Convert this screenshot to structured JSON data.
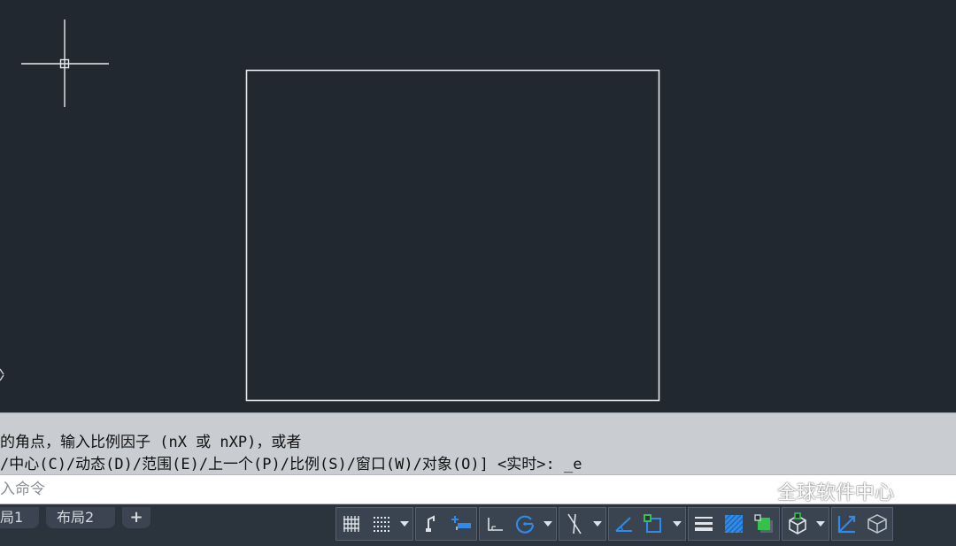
{
  "canvas": {
    "background": "#212830",
    "cursor": "crosshair-cursor-icon",
    "drawn_rectangle": "rectangle"
  },
  "command_history": {
    "line1": "的角点，输入比例因子 (nX 或 nXP)，或者",
    "line2": "/中心(C)/动态(D)/范围(E)/上一个(P)/比例(S)/窗口(W)/对象(O)] <实时>: _e"
  },
  "command_input": {
    "placeholder": "入命令",
    "value": ""
  },
  "watermark": {
    "text": "全球软件中心"
  },
  "layout_tabs": [
    {
      "label": "局1"
    },
    {
      "label": "布局2"
    },
    {
      "label": "+"
    }
  ],
  "status_icons": [
    "grid-icon",
    "grid-dots-icon",
    "dropdown-arrow-icon",
    "snap-icon",
    "infer-constraints-icon",
    "ortho-icon",
    "polar-tracking-icon",
    "dropdown-arrow-icon",
    "object-snap-tracking-icon",
    "dropdown-arrow-icon",
    "isometric-drafting-icon",
    "object-snap-icon",
    "dropdown-arrow-icon",
    "lineweight-icon",
    "transparency-icon",
    "selection-cycling-icon",
    "3d-object-snap-icon",
    "dropdown-arrow-icon",
    "dynamic-ucs-icon",
    "model-space-icon"
  ],
  "colors": {
    "canvas_bg": "#212830",
    "command_history_bg": "#c9ccd1",
    "statusbar_bg": "#2b333d",
    "active_icon": "#2f8ae8"
  }
}
